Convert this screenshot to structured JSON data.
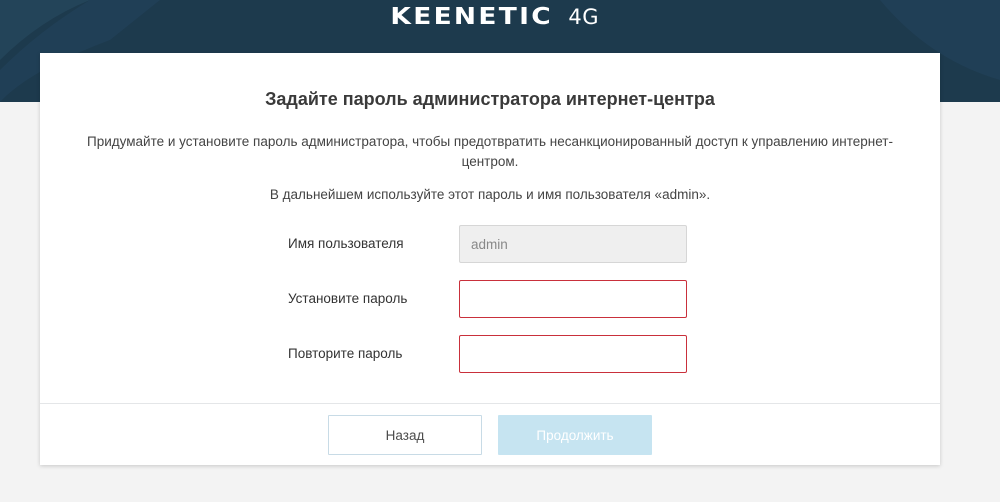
{
  "brand": {
    "name": "KEENETIC",
    "model": "4G"
  },
  "card": {
    "title": "Задайте пароль администратора интернет-центра",
    "description": "Придумайте и установите пароль администратора, чтобы предотвратить несанкционированный доступ к управлению интернет-центром.",
    "note": "В дальнейшем используйте этот пароль и имя пользователя «admin»."
  },
  "form": {
    "username_label": "Имя пользователя",
    "username_value": "admin",
    "password_label": "Установите пароль",
    "password_value": "",
    "repeat_label": "Повторите пароль",
    "repeat_value": ""
  },
  "buttons": {
    "back": "Назад",
    "continue": "Продолжить"
  },
  "colors": {
    "banner": "#1d3a4d",
    "error_border": "#c9303b",
    "disabled_button": "#c6e4f1"
  }
}
